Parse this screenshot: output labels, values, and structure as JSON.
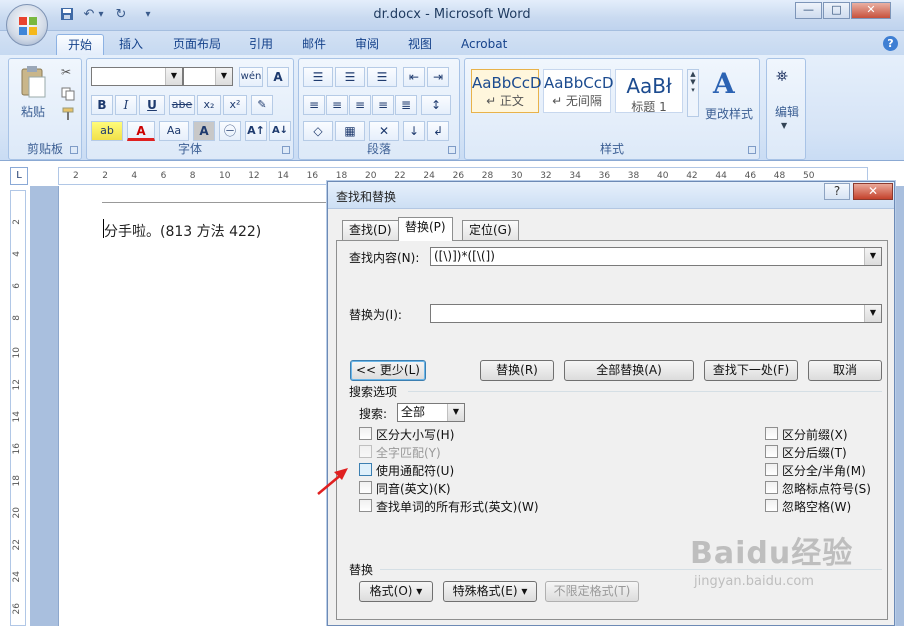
{
  "window": {
    "title": "dr.docx - Microsoft Word",
    "minimize": "—",
    "restore": "□",
    "close": "✕"
  },
  "quick_access": {
    "save_icon": "floppy-icon",
    "undo": "↶",
    "undo_dropdown": "▾",
    "redo": "↻",
    "customize": "▾"
  },
  "tabs": [
    "开始",
    "插入",
    "页面布局",
    "引用",
    "邮件",
    "审阅",
    "视图",
    "Acrobat"
  ],
  "active_tab": "开始",
  "ribbon": {
    "clipboard": {
      "label": "剪贴板",
      "paste": "粘贴",
      "cut_icon": "scissors-icon",
      "copy_icon": "copy-icon",
      "format_painter_icon": "brush-icon"
    },
    "font": {
      "label": "字体",
      "font_name": "",
      "font_size": "",
      "buttons_row1": [
        "wén",
        "A"
      ],
      "buttons_row2": [
        "B",
        "I",
        "U",
        "abe",
        "x₂",
        "x²",
        "✎"
      ],
      "buttons_row3": [
        "ab",
        "A",
        "Aa",
        "A",
        "㊀",
        "A↑",
        "A↓"
      ]
    },
    "paragraph": {
      "label": "段落"
    },
    "styles": {
      "label": "样式",
      "items": [
        {
          "sample": "AaBbCcD",
          "name": "↵ 正文"
        },
        {
          "sample": "AaBbCcD",
          "name": "↵ 无间隔"
        },
        {
          "sample": "AaBł",
          "name": "标题 1"
        }
      ],
      "change_styles": "更改样式"
    },
    "editing": {
      "label": "编辑"
    }
  },
  "ruler": {
    "corner": "L",
    "ticks": [
      "2",
      "2",
      "4",
      "6",
      "8",
      "10",
      "12",
      "14",
      "16",
      "18",
      "20",
      "22",
      "24",
      "26",
      "28",
      "30",
      "32",
      "34",
      "36",
      "38",
      "40",
      "42",
      "44",
      "46",
      "48",
      "50"
    ],
    "vticks": [
      "2",
      "4",
      "6",
      "8",
      "10",
      "12",
      "14",
      "16",
      "18",
      "20",
      "22",
      "24",
      "26"
    ]
  },
  "document": {
    "text": "分手啦。(813 方法 422)"
  },
  "dialog": {
    "title": "查找和替换",
    "help": "?",
    "close": "✕",
    "tabs": [
      "查找(D)",
      "替换(P)",
      "定位(G)"
    ],
    "active_tab": "替换(P)",
    "find_label": "查找内容(N):",
    "find_value": "([\\)])*([\\(])",
    "replace_label": "替换为(I):",
    "replace_value": "",
    "buttons": {
      "less": "<< 更少(L)",
      "replace": "替换(R)",
      "replace_all": "全部替换(A)",
      "find_next": "查找下一处(F)",
      "cancel": "取消"
    },
    "search_options_label": "搜索选项",
    "search_label": "搜索:",
    "search_value": "全部",
    "left_options": [
      {
        "label": "区分大小写(H)",
        "checked": false,
        "disabled": false
      },
      {
        "label": "全字匹配(Y)",
        "checked": false,
        "disabled": true
      },
      {
        "label": "使用通配符(U)",
        "checked": false,
        "disabled": false,
        "highlight": true
      },
      {
        "label": "同音(英文)(K)",
        "checked": false,
        "disabled": false
      },
      {
        "label": "查找单词的所有形式(英文)(W)",
        "checked": false,
        "disabled": false
      }
    ],
    "right_options": [
      {
        "label": "区分前缀(X)",
        "checked": false
      },
      {
        "label": "区分后缀(T)",
        "checked": false
      },
      {
        "label": "区分全/半角(M)",
        "checked": false
      },
      {
        "label": "忽略标点符号(S)",
        "checked": false
      },
      {
        "label": "忽略空格(W)",
        "checked": false
      }
    ],
    "replace_section_label": "替换",
    "format_button": "格式(O) ▾",
    "special_button": "特殊格式(E) ▾",
    "no_format_button": "不限定格式(T)"
  },
  "annotation": {
    "arrow_color": "#e02020"
  },
  "watermark": {
    "line1": "Baidu经验",
    "line2": "jingyan.baidu.com"
  },
  "colors": {
    "ribbon_text": "#15428b",
    "dialog_bg": "#f0f0f0"
  }
}
